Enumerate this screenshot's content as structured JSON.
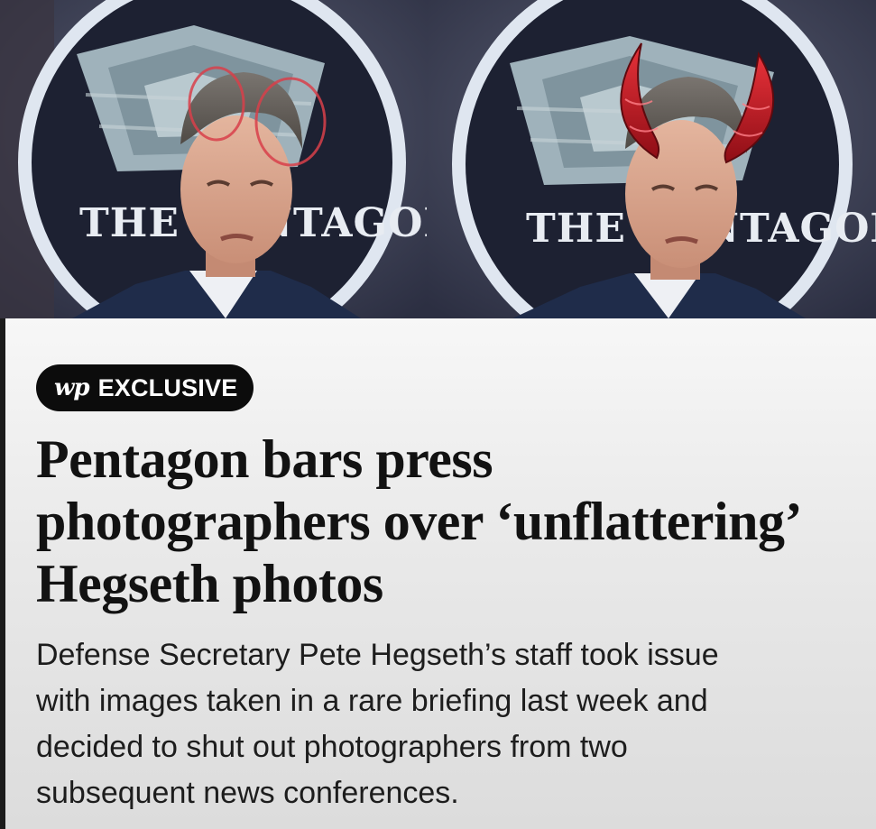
{
  "photos": {
    "left": {
      "seal_text": "THE PENTAGON",
      "alt": "Original press photo with red circles drawn on the hair"
    },
    "right": {
      "seal_text": "THE PENTAGON",
      "alt": "Same press photo with red devil horns added"
    }
  },
  "badge": {
    "logo": "wp",
    "label": "EXCLUSIVE"
  },
  "headline": {
    "lines": [
      "Pentagon bars press",
      "photographers over ‘unflattering’",
      "Hegseth photos"
    ]
  },
  "dek": {
    "lines": [
      "Defense Secretary Pete Hegseth’s staff took issue",
      "with images taken in a rare briefing last week and",
      "decided to shut out photographers from two",
      "subsequent news conferences."
    ]
  },
  "colors": {
    "badge_bg": "#0c0c0c",
    "headline": "#121212",
    "annotation_red": "#d8404a",
    "horn_red": "#b2161f",
    "seal_ring": "#dfe6f0",
    "suit_navy": "#1f2c4a"
  }
}
